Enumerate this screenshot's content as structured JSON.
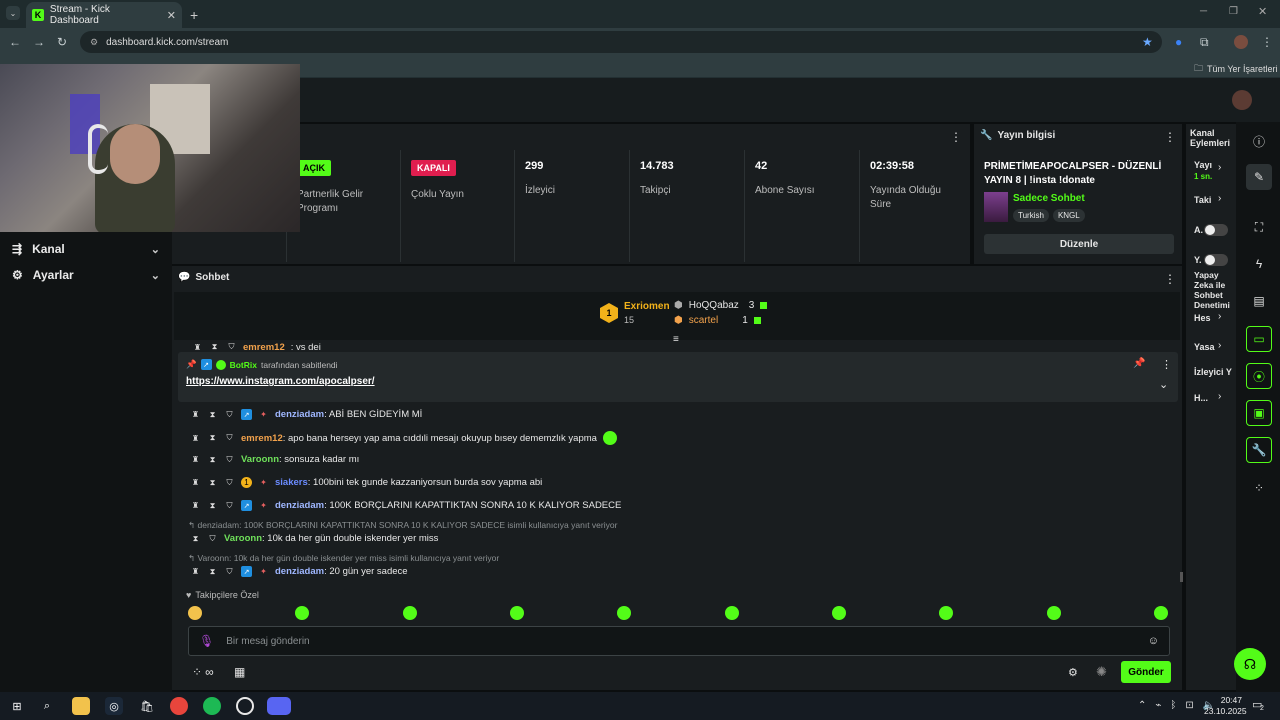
{
  "browser": {
    "tab_title": "Stream - Kick Dashboard",
    "tab_favicon": "K",
    "url": "dashboard.kick.com/stream",
    "bookmarks_all": "Tüm Yer İşaretleri"
  },
  "nav": {
    "items": [
      {
        "label": "Kanal",
        "icon": "broadcast-icon"
      },
      {
        "label": "Ayarlar",
        "icon": "gear-icon"
      }
    ]
  },
  "stats": [
    {
      "value_pill": "AÇIK",
      "label": "Partnerlik Gelir Programı",
      "pill_color": "#53fc18"
    },
    {
      "value_pill": "KAPALI",
      "label": "Çoklu Yayın",
      "pill_color": "#e01e4f"
    },
    {
      "value": "299",
      "label": "İzleyici"
    },
    {
      "value": "14.783",
      "label": "Takipçi"
    },
    {
      "value": "42",
      "label": "Abone Sayısı"
    },
    {
      "value": "02:39:58",
      "label": "Yayında Olduğu Süre"
    }
  ],
  "info": {
    "header": "Yayın bilgisi",
    "title": "PRİMETİMEAPOCALPSER - DÜZENLİ YAYIN 8 | !insta !donate",
    "category": "Sadece Sohbet",
    "tags": [
      "Turkish",
      "KNGL"
    ],
    "edit_button": "Düzenle"
  },
  "chat": {
    "header": "Sohbet",
    "leaderboard": {
      "first_name": "Exriomen",
      "first_count": "15",
      "others": [
        {
          "name": "HoQQabaz",
          "count": "3"
        },
        {
          "name": "scartel",
          "count": "1"
        }
      ]
    },
    "partial_top": {
      "user": "emrem12",
      "text": ": vs dei"
    },
    "pinned": {
      "by_user": "BotRix",
      "by_text": "tarafından sabitlendi",
      "link": "https://www.instagram.com/apocalpser/"
    },
    "messages": [
      {
        "user": "denziadam",
        "color": "#9fb7ff",
        "text": ": ABİ BEN GİDEYİM Mİ"
      },
      {
        "user": "emrem12",
        "color": "#f2a24c",
        "text": ": apo bana herseyı yap ama cıddıli mesajı okuyup bısey dememzlık yapma"
      },
      {
        "user": "Varoonn",
        "color": "#6fe05a",
        "text": ": sonsuza kadar mı"
      },
      {
        "user": "siakers",
        "color": "#6b8cff",
        "text": ": 100bini tek gunde kazzaniyorsun burda sov yapma abi"
      },
      {
        "user": "denziadam",
        "color": "#9fb7ff",
        "text": ": 100K BORÇLARINI KAPATTIKTAN SONRA 10 K KALIYOR SADECE"
      },
      {
        "user": "Varoonn",
        "color": "#6fe05a",
        "text": ": 10k da her gün double iskender yer miss"
      },
      {
        "user": "denziadam",
        "color": "#9fb7ff",
        "text": ": 20 gün yer sadece"
      }
    ],
    "replies": [
      "denziadam: 100K BORÇLARINI KAPATTIKTAN SONRA 10 K KALIYOR SADECE isimli kullanıcıya yanıt veriyor",
      "Varoonn: 10k da her gün double iskender yer miss isimli kullanıcıya yanıt veriyor"
    ],
    "emote_section": "Takipçilere Özel",
    "input_placeholder": "Bir mesaj gönderin",
    "send_button": "Gönder",
    "infinity": "∞"
  },
  "right_panel": {
    "header": "Kanal Eylemleri",
    "items": [
      "Yayı",
      "1 sn.",
      "Taki",
      "A.",
      "Y.",
      "Yapay Zeka ile Sohbet Denetimi",
      "Hes",
      "Yasa",
      "İzleyici Y",
      "H..."
    ]
  },
  "taskbar": {
    "time": "20:47",
    "date": "23.10.2025",
    "notif": "2"
  },
  "colors": {
    "accent": "#53fc18",
    "panel": "#191d1f",
    "background": "#0b0e0f"
  }
}
